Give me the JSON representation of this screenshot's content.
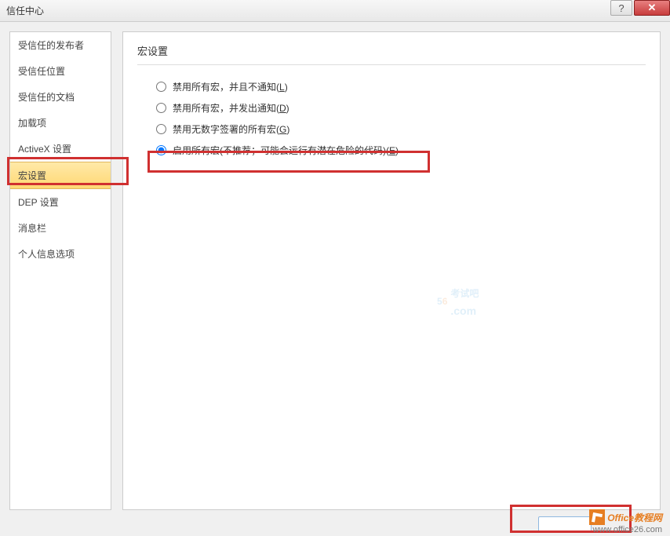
{
  "title": "信任中心",
  "titlebar": {
    "help_symbol": "?",
    "close_symbol": "✕"
  },
  "sidebar": {
    "items": [
      {
        "label": "受信任的发布者"
      },
      {
        "label": "受信任位置"
      },
      {
        "label": "受信任的文档"
      },
      {
        "label": "加载项"
      },
      {
        "label": "ActiveX 设置"
      },
      {
        "label": "宏设置"
      },
      {
        "label": "DEP 设置"
      },
      {
        "label": "消息栏"
      },
      {
        "label": "个人信息选项"
      }
    ],
    "selected_index": 5
  },
  "main": {
    "section_title": "宏设置",
    "options": [
      {
        "label_prefix": "禁用所有宏，并且不通知(",
        "accesskey": "L",
        "label_suffix": ")"
      },
      {
        "label_prefix": "禁用所有宏，并发出通知(",
        "accesskey": "D",
        "label_suffix": ")"
      },
      {
        "label_prefix": "禁用无数字签署的所有宏(",
        "accesskey": "G",
        "label_suffix": ")"
      },
      {
        "label_prefix": "启用所有宏(不推荐；可能会运行有潜在危险的代码)(",
        "accesskey": "E",
        "label_suffix": ")"
      }
    ],
    "selected_index": 3
  },
  "watermark": {
    "num1": "5",
    "num2": "6",
    "text": "考试吧",
    "domain": ".com"
  },
  "brand": {
    "name": "Office教程网",
    "url": "www.office26.com"
  }
}
